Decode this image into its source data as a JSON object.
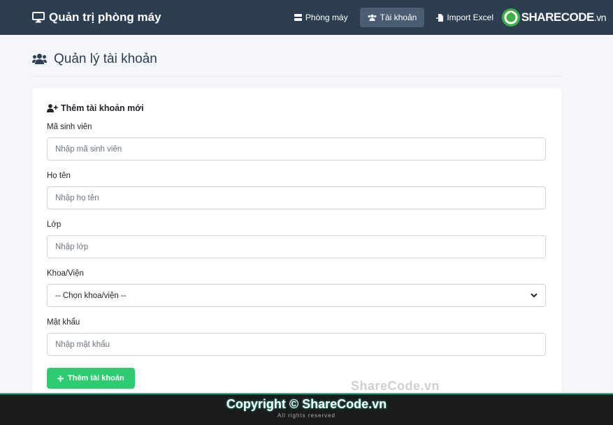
{
  "navbar": {
    "brand": "Quản trị phòng máy",
    "items": [
      {
        "label": "Phòng máy",
        "icon": "server-icon",
        "active": false
      },
      {
        "label": "Tài khoản",
        "icon": "users-icon",
        "active": true
      },
      {
        "label": "Import Excel",
        "icon": "file-import-icon",
        "active": false
      }
    ],
    "logo": {
      "main": "SHARECODE",
      "suffix": ".vn"
    }
  },
  "page": {
    "title": "Quản lý tài khoản"
  },
  "form": {
    "title": "Thêm tài khoản mới",
    "fields": [
      {
        "label": "Mã sinh viên",
        "placeholder": "Nhập mã sinh viên"
      },
      {
        "label": "Họ tên",
        "placeholder": "Nhập họ tên"
      },
      {
        "label": "Lớp",
        "placeholder": "Nhập lớp"
      },
      {
        "label": "Khoa/Viện",
        "selected": "-- Chọn khoa/viện --"
      },
      {
        "label": "Mật khẩu",
        "placeholder": "Nhập mật khẩu"
      }
    ],
    "submit_label": "Thêm tài khoản"
  },
  "watermark": "ShareCode.vn",
  "footer": {
    "copyright": "Copyright © ShareCode.vn",
    "rights": "All rights reserved"
  }
}
